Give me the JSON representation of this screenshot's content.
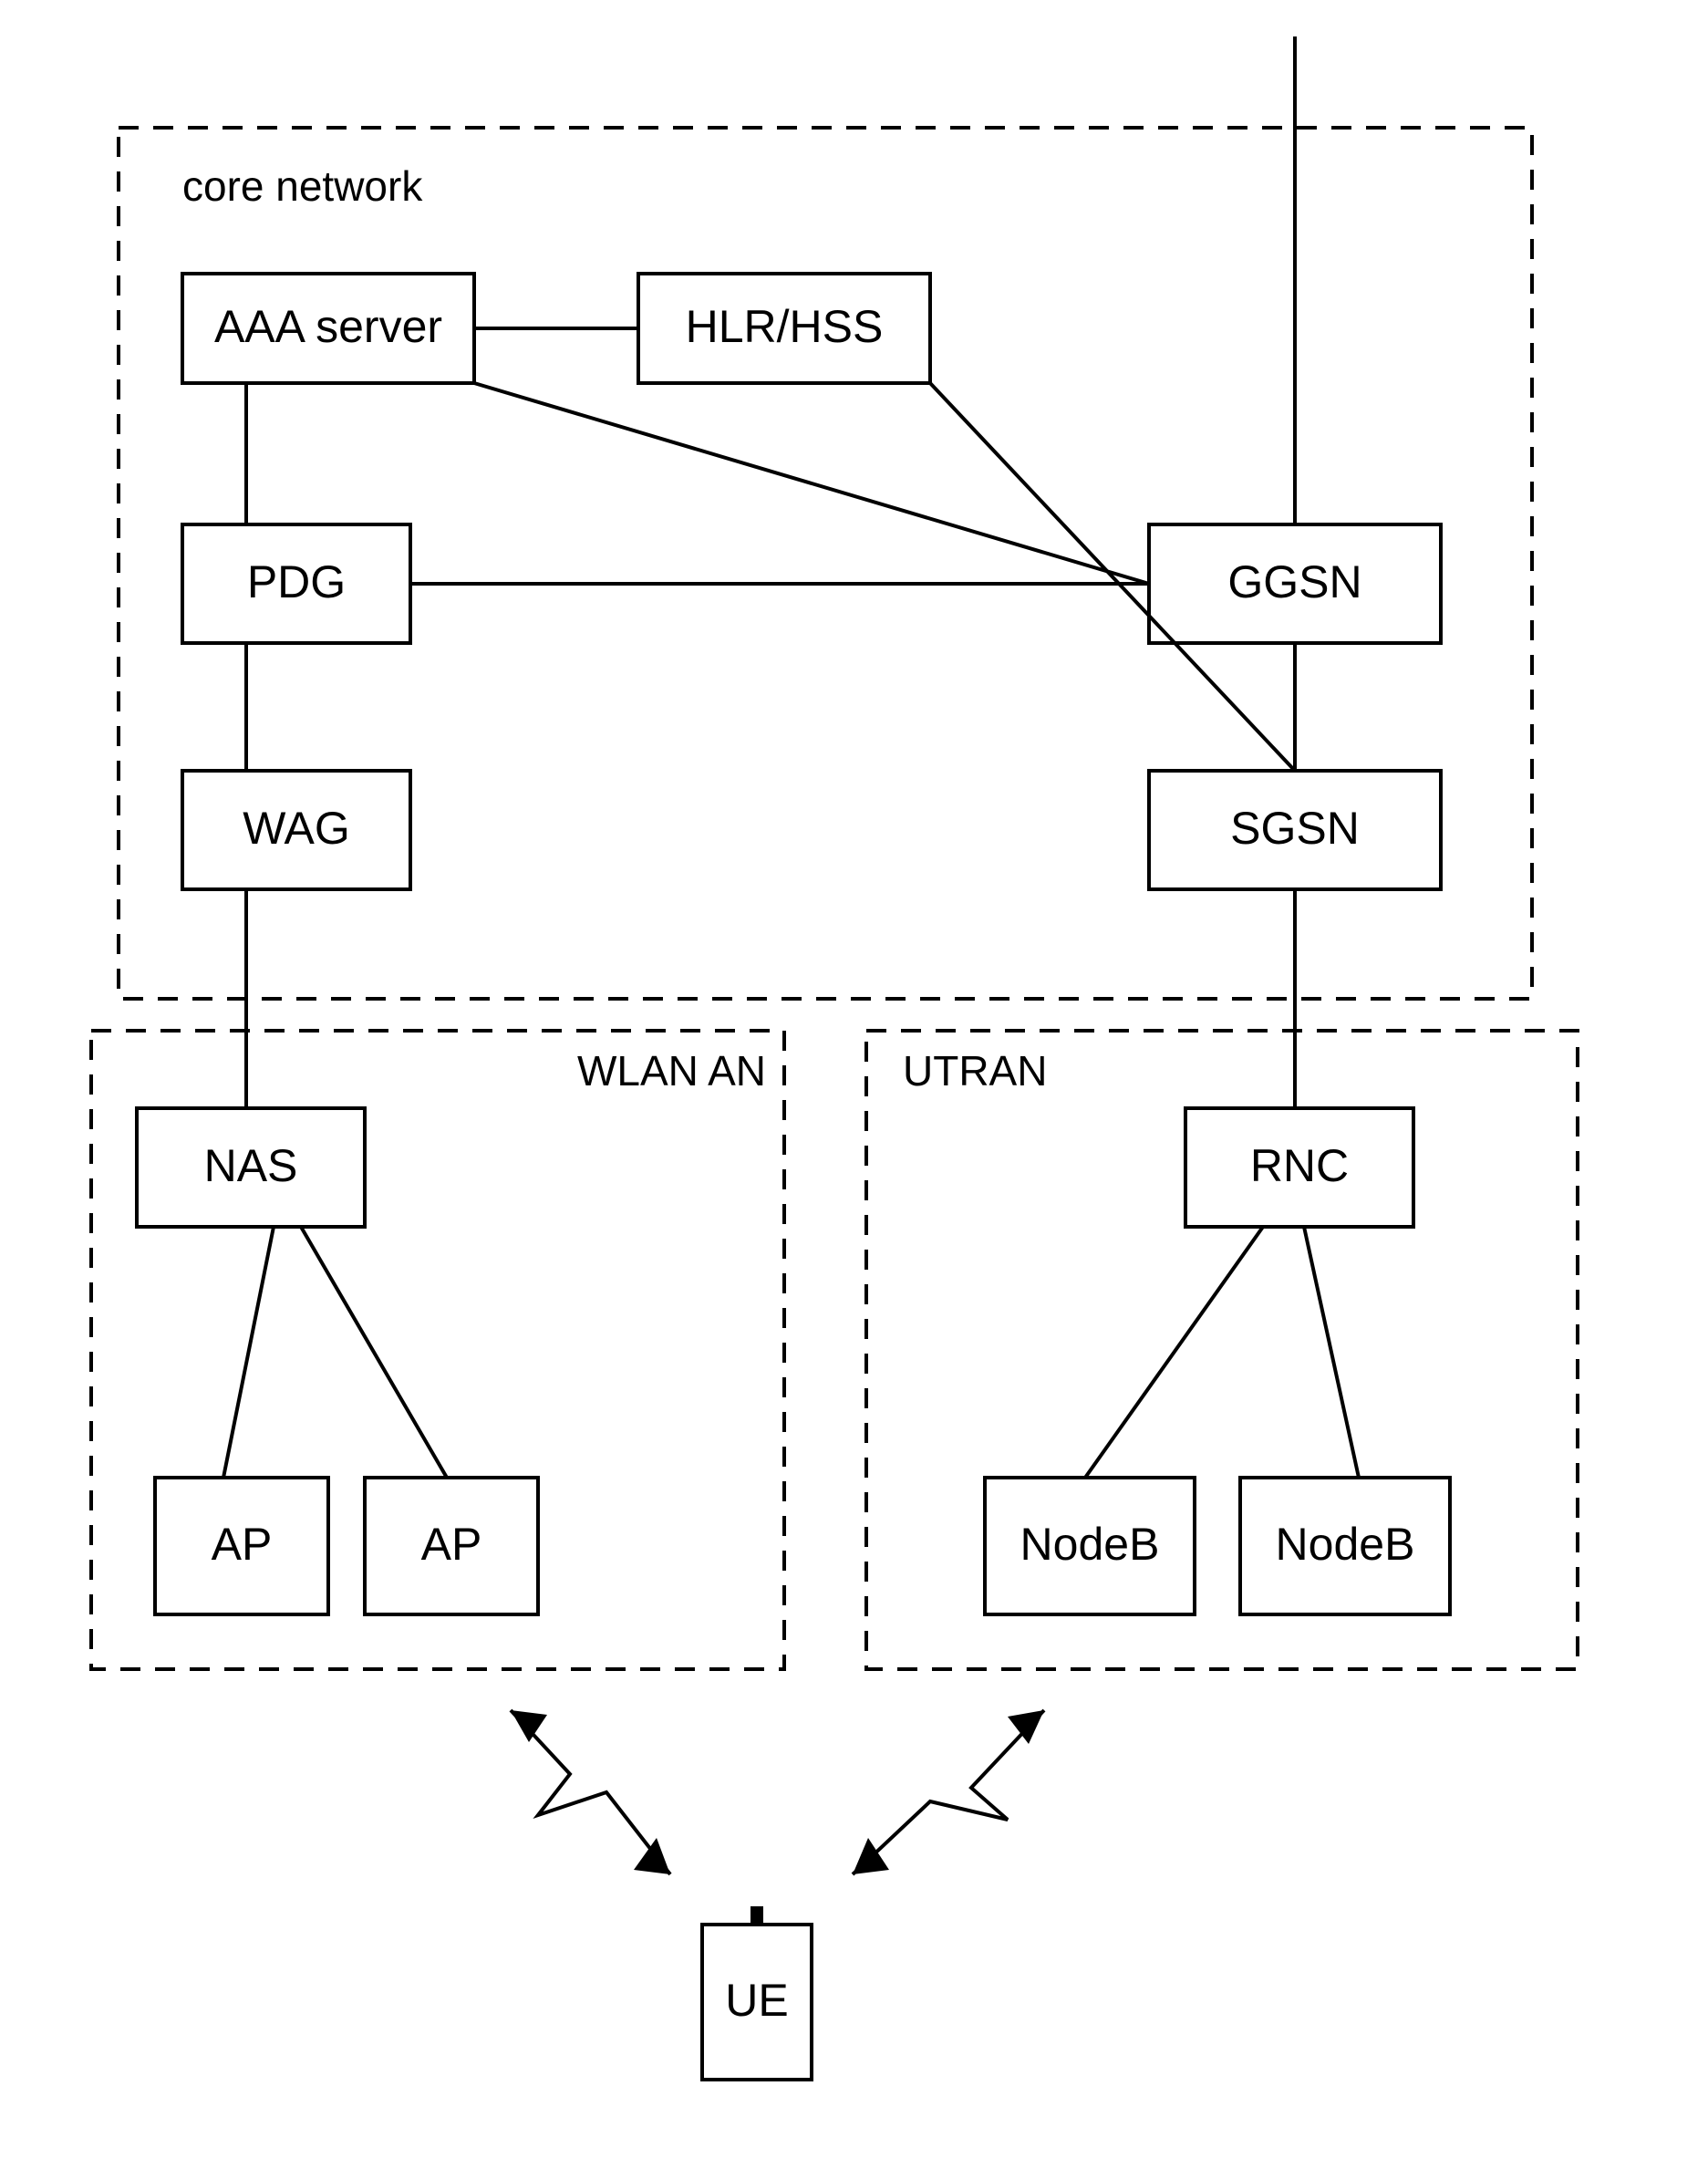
{
  "diagram": {
    "groups": {
      "core": "core network",
      "wlan": "WLAN AN",
      "utran": "UTRAN"
    },
    "nodes": {
      "aaa": "AAA server",
      "hlr": "HLR/HSS",
      "pdg": "PDG",
      "ggsn": "GGSN",
      "wag": "WAG",
      "sgsn": "SGSN",
      "nas": "NAS",
      "rnc": "RNC",
      "ap1": "AP",
      "ap2": "AP",
      "nb1": "NodeB",
      "nb2": "NodeB",
      "ue": "UE"
    }
  }
}
